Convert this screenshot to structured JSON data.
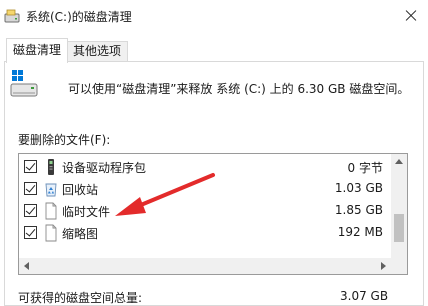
{
  "window": {
    "title": "系统(C:)的磁盘清理",
    "icon": "disk-cleanup-icon"
  },
  "tabs": [
    {
      "label": "磁盘清理",
      "active": true
    },
    {
      "label": "其他选项",
      "active": false
    }
  ],
  "info": {
    "text": "可以使用“磁盘清理”来释放 系统 (C:) 上的 6.30 GB 磁盘空间。"
  },
  "files_section": {
    "label": "要删除的文件(F):",
    "items": [
      {
        "name": "设备驱动程序包",
        "size": "0 字节",
        "checked": true,
        "icon": "driver-package-icon"
      },
      {
        "name": "回收站",
        "size": "1.03 GB",
        "checked": true,
        "icon": "recycle-bin-icon"
      },
      {
        "name": "临时文件",
        "size": "1.85 GB",
        "checked": true,
        "icon": "file-icon"
      },
      {
        "name": "缩略图",
        "size": "192 MB",
        "checked": true,
        "icon": "file-icon"
      }
    ]
  },
  "total": {
    "label": "可获得的磁盘空间总量:",
    "value": "3.07 GB"
  },
  "colors": {
    "annotation_arrow": "#e32b2b",
    "windows_logo": "#0078d7"
  }
}
